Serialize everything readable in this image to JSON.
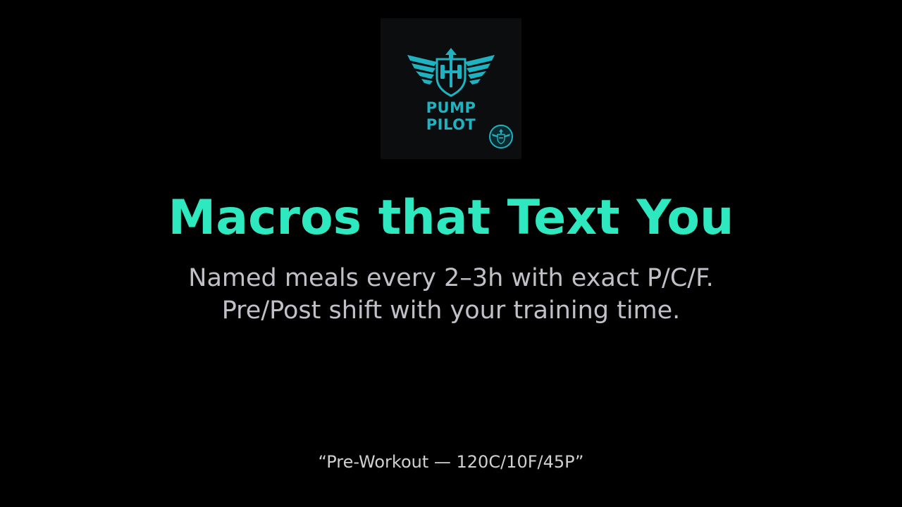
{
  "logo": {
    "word_1": "PUMP",
    "word_2": "PILOT",
    "emblem_icon": "winged-dumbbell-arrow-icon",
    "badge_icon": "mini-emblem-badge-icon"
  },
  "hero": {
    "headline": "Macros that Text You",
    "subline_1": "Named meals every 2–3h with exact P/C/F.",
    "subline_2": "Pre/Post shift with your training time."
  },
  "example_quote": "“Pre-Workout — 120C/10F/45P”",
  "colors": {
    "background": "#000000",
    "logo_tile": "#0c0d0e",
    "accent": "#2ee8c0",
    "logo_teal": "#1fb2c0",
    "subtext": "#c0c0c8",
    "quote_text": "#d0d0d0"
  }
}
